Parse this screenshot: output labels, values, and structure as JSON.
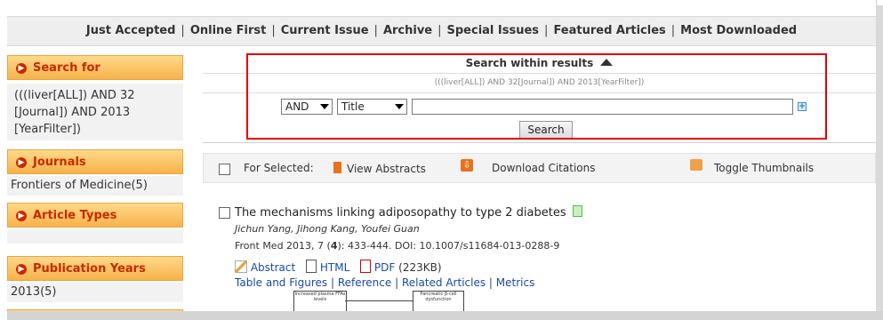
{
  "top_nav": {
    "items": [
      "Just Accepted",
      "Online First",
      "Current Issue",
      "Archive",
      "Special Issues",
      "Featured Articles",
      "Most Downloaded"
    ],
    "separator": "|"
  },
  "sidebar": {
    "search_for": {
      "title": "Search for",
      "value": "(((liver[ALL]) AND 32 [Journal]) AND 2013 [YearFilter])"
    },
    "journals": {
      "title": "Journals",
      "value": "Frontiers of Medicine(5)"
    },
    "article_types": {
      "title": "Article Types"
    },
    "publication_years": {
      "title": "Publication Years",
      "value": "2013(5)"
    }
  },
  "search_within": {
    "title": "Search within results",
    "query": "(((liver[ALL]) AND 32[Journal]) AND 2013[YearFilter])",
    "operator": "AND",
    "field": "Title",
    "input_value": "",
    "button": "Search"
  },
  "for_selected": {
    "label": "For Selected:",
    "view_abstracts": "View Abstracts",
    "download_citations": "Download Citations",
    "toggle_thumbnails": "Toggle Thumbnails"
  },
  "article": {
    "title": "The mechanisms linking adiposopathy to type 2 diabetes",
    "authors": "Jichun Yang, Jihong Kang, Youfei Guan",
    "citation_prefix": "Front Med   2013, 7 (",
    "citation_issue": "4",
    "citation_suffix": "): 433-444.   DOI: 10.1007/s11684-013-0288-9",
    "abstract": "Abstract",
    "html": "HTML",
    "pdf": "PDF",
    "pdf_size": "(223KB)",
    "links": [
      "Table and Figures",
      "Reference",
      "Related Articles",
      "Metrics"
    ],
    "thumb_box1": "Increased plasma FFAs levels",
    "thumb_box2": "Pancreatic β-cell dysfunction"
  },
  "colors": {
    "accent_red": "#e40000",
    "sidebar_head_text": "#c62a00",
    "sidebar_head_bg": "#f7b24a",
    "link_blue": "#1a4aa8"
  }
}
